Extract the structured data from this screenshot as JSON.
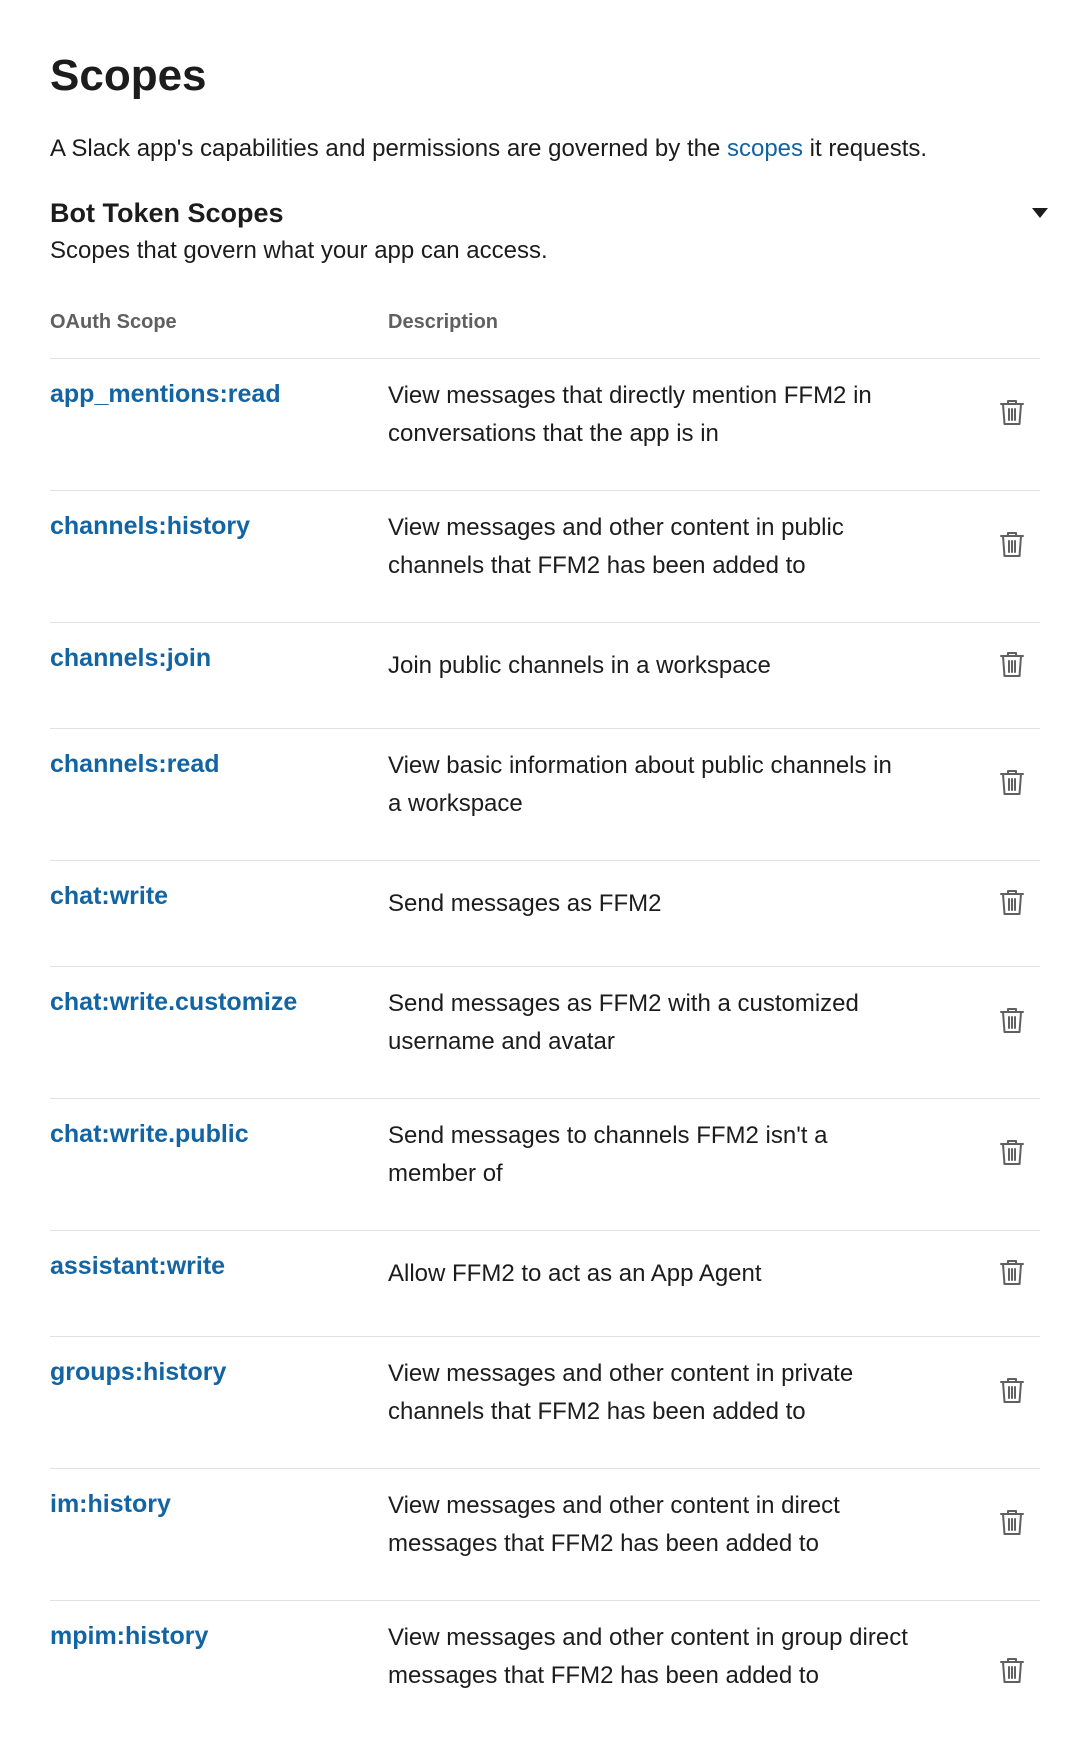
{
  "header": {
    "title": "Scopes",
    "intro_before": "A Slack app's capabilities and permissions are governed by the ",
    "intro_link": "scopes",
    "intro_after": " it requests."
  },
  "section": {
    "title": "Bot Token Scopes",
    "subtitle": "Scopes that govern what your app can access.",
    "toggle_icon": "caret-down-icon"
  },
  "table": {
    "col_scope": "OAuth Scope",
    "col_desc": "Description",
    "rows": [
      {
        "scope": "app_mentions:read",
        "description": "View messages that directly mention FFM2 in conversations that the app is in"
      },
      {
        "scope": "channels:history",
        "description": "View messages and other content in public channels that FFM2 has been added to"
      },
      {
        "scope": "channels:join",
        "description": "Join public channels in a workspace"
      },
      {
        "scope": "channels:read",
        "description": "View basic information about public channels in a workspace"
      },
      {
        "scope": "chat:write",
        "description": "Send messages as FFM2"
      },
      {
        "scope": "chat:write.customize",
        "description": "Send messages as FFM2 with a customized username and avatar"
      },
      {
        "scope": "chat:write.public",
        "description": "Send messages to channels FFM2 isn't a member of"
      },
      {
        "scope": "assistant:write",
        "description": "Allow FFM2 to act as an App Agent"
      },
      {
        "scope": "groups:history",
        "description": "View messages and other content in private channels that FFM2 has been added to"
      },
      {
        "scope": "im:history",
        "description": "View messages and other content in direct messages that FFM2 has been added to"
      },
      {
        "scope": "mpim:history",
        "description": "View messages and other content in group direct messages that FFM2 has been added to"
      }
    ],
    "row_action_icon": "trash-icon"
  },
  "colors": {
    "link": "#1264a3",
    "text": "#1d1c1d",
    "muted": "#616061",
    "divider": "#e2e2e2"
  }
}
